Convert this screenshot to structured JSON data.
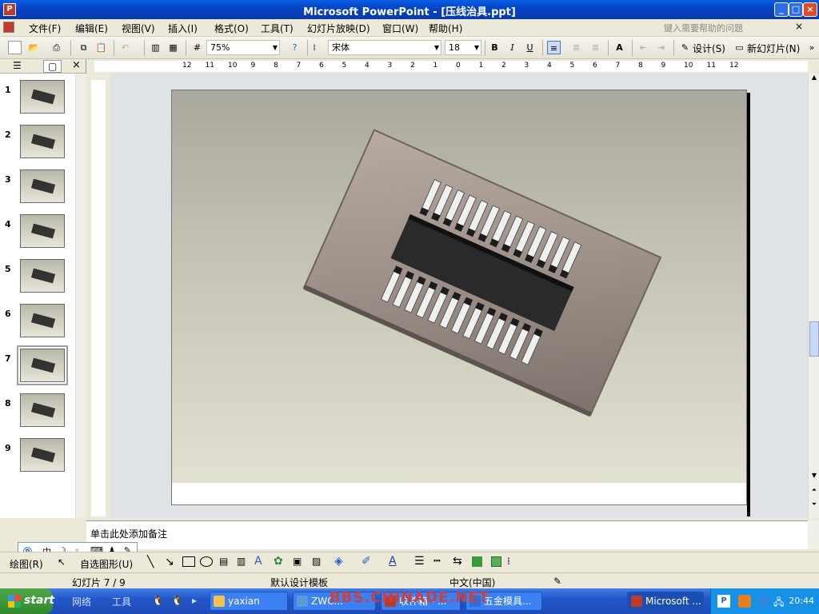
{
  "window": {
    "title": "Microsoft PowerPoint - [压线治具.ppt]"
  },
  "menu": [
    {
      "label": "文件(F)"
    },
    {
      "label": "编辑(E)"
    },
    {
      "label": "视图(V)"
    },
    {
      "label": "插入(I)"
    },
    {
      "label": "格式(O)"
    },
    {
      "label": "工具(T)"
    },
    {
      "label": "幻灯片放映(D)"
    },
    {
      "label": "窗口(W)"
    },
    {
      "label": "帮助(H)"
    }
  ],
  "help": {
    "placeholder": "键入需要帮助的问题"
  },
  "toolbar": {
    "zoom": "75%",
    "font": "宋体",
    "font_size": "18",
    "bold": "B",
    "italic": "I",
    "underline": "U",
    "design_label": "设计(S)",
    "new_slide_label": "新幻灯片(N)"
  },
  "ruler_h": [
    "12",
    "11",
    "10",
    "9",
    "8",
    "7",
    "6",
    "5",
    "4",
    "3",
    "2",
    "1",
    "0",
    "1",
    "2",
    "3",
    "4",
    "5",
    "6",
    "7",
    "8",
    "9",
    "10",
    "11",
    "12"
  ],
  "slides": [
    {
      "num": "1"
    },
    {
      "num": "2"
    },
    {
      "num": "3"
    },
    {
      "num": "4"
    },
    {
      "num": "5"
    },
    {
      "num": "6"
    },
    {
      "num": "7",
      "selected": true
    },
    {
      "num": "8"
    },
    {
      "num": "9"
    }
  ],
  "notes": {
    "placeholder": "单击此处添加备注"
  },
  "drawbar": {
    "draw_label": "绘图(R)",
    "autoshape_label": "自选图形(U)"
  },
  "ime": {
    "mode": "中"
  },
  "status": {
    "slide_pos": "幻灯片 7 / 9",
    "template": "默认设计模板",
    "language": "中文(中国)"
  },
  "taskbar": {
    "start": "start",
    "quick": [
      "网络",
      "工具"
    ],
    "buttons": [
      {
        "label": "yaxian",
        "color": "#f2c24b"
      },
      {
        "label": "ZWC...",
        "color": "#5b9bd5"
      },
      {
        "label": "收件箱 - ...",
        "color": "#c0392b"
      },
      {
        "label": "五金模具...",
        "color": "#2c6fd6"
      },
      {
        "label": "Microsoft ...",
        "color": "#c0392b",
        "active": true
      }
    ],
    "clock": "20:44",
    "watermark": "BBS.CHINADE.NET"
  },
  "colors": {
    "titlebar": "#0542c4",
    "taskbar": "#2457c8",
    "start": "#2f8a2c"
  }
}
